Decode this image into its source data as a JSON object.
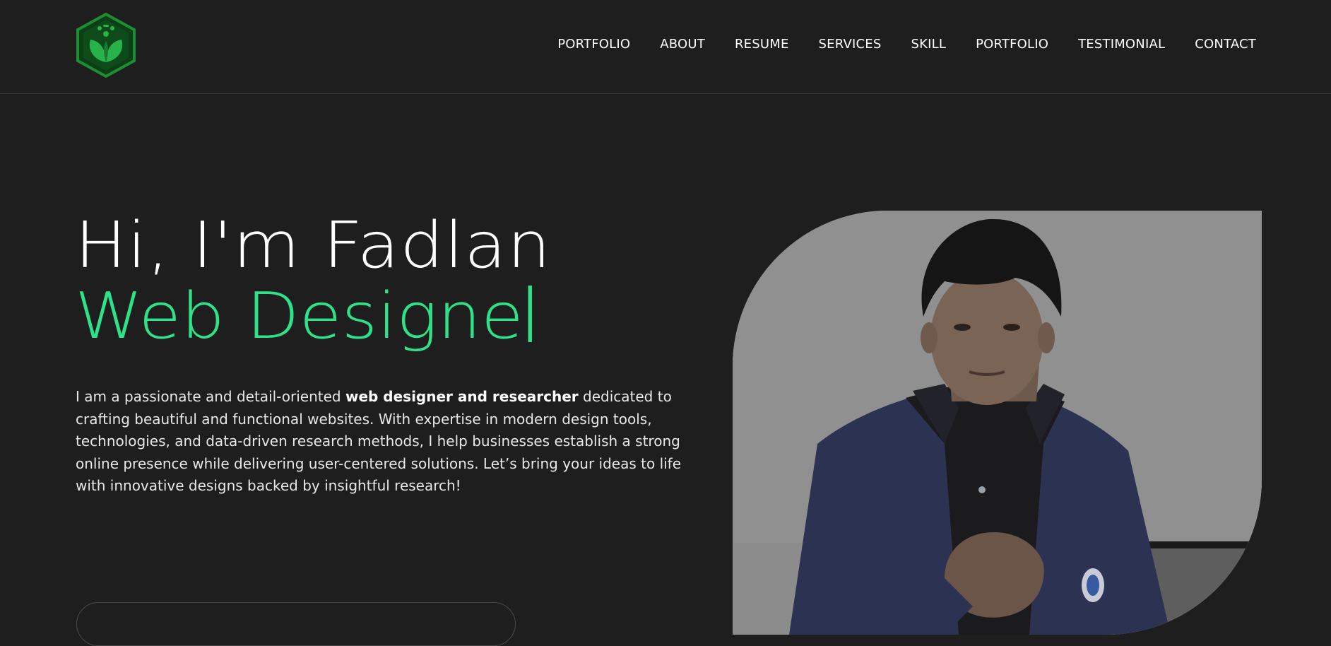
{
  "header": {
    "logo_icon": "leaf-hexagon-logo",
    "nav": [
      {
        "label": "PORTFOLIO"
      },
      {
        "label": "ABOUT"
      },
      {
        "label": "RESUME"
      },
      {
        "label": "SERVICES"
      },
      {
        "label": "SKILL"
      },
      {
        "label": "PORTFOLIO"
      },
      {
        "label": "TESTIMONIAL"
      },
      {
        "label": "CONTACT"
      }
    ]
  },
  "hero": {
    "greeting": "Hi, I'm Fadlan",
    "role": "Web Designe",
    "bio_before": "I am a passionate and detail-oriented ",
    "bio_bold": "web designer and researcher",
    "bio_after": " dedicated to crafting beautiful and functional websites. With expertise in modern design tools, technologies, and data-driven research methods, I help businesses establish a strong online presence while delivering user-centered solutions. Let’s bring your ideas to life with innovative designs backed by insightful research!"
  },
  "colors": {
    "background": "#1e1e1e",
    "accent": "#2ee28a",
    "text": "#ffffff"
  }
}
